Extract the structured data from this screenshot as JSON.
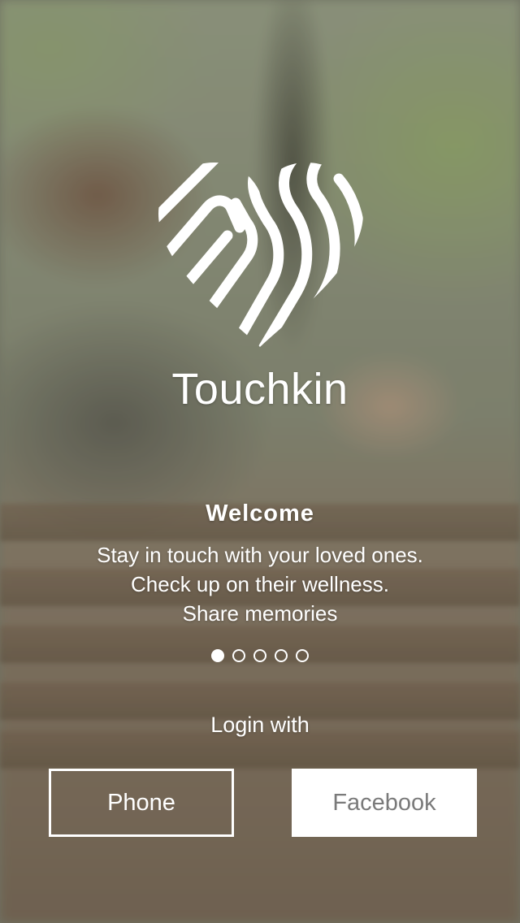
{
  "app": {
    "name": "Touchkin"
  },
  "onboarding": {
    "title": "Welcome",
    "lines": [
      "Stay in touch with your loved ones.",
      "Check up on their wellness.",
      "Share memories"
    ],
    "page_indicator": {
      "total": 5,
      "active_index": 0
    }
  },
  "login": {
    "label": "Login with",
    "phone_label": "Phone",
    "facebook_label": "Facebook"
  },
  "colors": {
    "text": "#ffffff",
    "facebook_button_bg": "#ffffff",
    "facebook_button_text": "#7a7a7a"
  },
  "icons": {
    "logo": "heart-fingerprint-icon"
  }
}
